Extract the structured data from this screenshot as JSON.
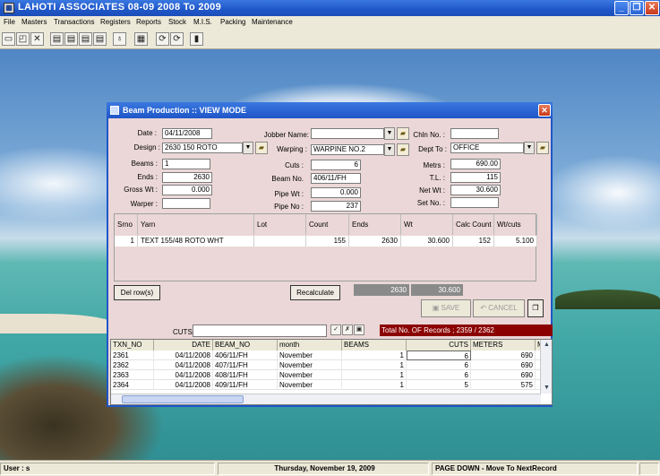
{
  "app": {
    "title": "LAHOTI ASSOCIATES 08-09     2008   To   2009",
    "icon": "app-icon"
  },
  "menu": [
    "File",
    "Masters",
    "Transactions",
    "Registers",
    "Reports",
    "Stock",
    "M.I.S.",
    "Packing",
    "Maintenance"
  ],
  "toolbar": {
    "icons": [
      "new-doc-icon",
      "new-record-icon",
      "delete-icon",
      "first-record-icon",
      "previous-record-icon",
      "next-record-icon",
      "last-record-icon",
      "find-icon",
      "print-icon",
      "refresh-icon",
      "export-icon",
      "exit-icon"
    ],
    "glyphs": [
      "▭",
      "◰",
      "✕",
      "▤",
      "▤",
      "▤",
      "▤",
      "♁",
      "▦",
      "⟳",
      "⟳",
      "▮"
    ]
  },
  "dialog": {
    "title": "Beam Production :: VIEW MODE",
    "close": "✕",
    "fields": {
      "date_label": "Date :",
      "date": "04/11/2008",
      "design_label": "Design :",
      "design": "2630 150 ROTO",
      "beams_label": "Beams :",
      "beams": "1",
      "ends_label": "Ends :",
      "ends": "2630",
      "gross_wt_label": "Gross Wt :",
      "gross_wt": "0.000",
      "warper_label": "Warper :",
      "warper": "",
      "jobber_label": "Jobber Name:",
      "jobber": "",
      "warping_label": "Warping :",
      "warping": "WARPINE NO.2",
      "cuts_label": "Cuts :",
      "cuts": "6",
      "beam_no_label": "Beam No.",
      "beam_no": "406/11/FH",
      "pipe_wt_label": "Pipe Wt :",
      "pipe_wt": "0.000",
      "pipe_no_label": "Pipe No :",
      "pipe_no": "237",
      "chln_label": "Chln No. :",
      "chln": "",
      "dept_label": "Dept To :",
      "dept": "OFFICE",
      "metrs_label": "Metrs :",
      "metrs": "690.00",
      "tl_label": "T.L. :",
      "tl": "115",
      "net_wt_label": "Net Wt :",
      "net_wt": "30.600",
      "set_no_label": "Set No. :",
      "set_no": ""
    },
    "grid": {
      "headers": [
        "Srno",
        "Yarn",
        "Lot",
        "Count",
        "Ends",
        "Wt",
        "Calc Count",
        "Wt/cuts"
      ],
      "rows": [
        [
          "1",
          "TEXT 155/48 ROTO WHT",
          "",
          "155",
          "2630",
          "30.600",
          "152",
          "5.100"
        ]
      ]
    },
    "buttons": {
      "del_rows": "Del row(s)",
      "recalculate": "Recalculate",
      "save": "SAVE",
      "cancel": "CANCEL"
    },
    "totals": {
      "ends": "2630",
      "wt": "30.600"
    },
    "search": {
      "label": "CUTS",
      "value": ""
    },
    "records": "Total No. OF Records ; 2359 / 2362",
    "list": {
      "headers": [
        "TXN_NO",
        "DATE",
        "BEAM_NO",
        "month",
        "BEAMS",
        "CUTS",
        "METERS",
        "M"
      ],
      "rows": [
        [
          "2361",
          "04/11/2008",
          "406/11/FH",
          "November",
          "1",
          "6",
          "690"
        ],
        [
          "2362",
          "04/11/2008",
          "407/11/FH",
          "November",
          "1",
          "6",
          "690"
        ],
        [
          "2363",
          "04/11/2008",
          "408/11/FH",
          "November",
          "1",
          "6",
          "690"
        ],
        [
          "2364",
          "04/11/2008",
          "409/11/FH",
          "November",
          "1",
          "5",
          "575"
        ]
      ]
    }
  },
  "status": {
    "user": "User : s",
    "date": "Thursday, November 19, 2009",
    "hint": "PAGE DOWN - Move To NextRecord"
  },
  "colors": {
    "title_blue": "#1f56c8",
    "dialog_bg": "#ebd7d7",
    "records_bg": "#8b0000"
  }
}
